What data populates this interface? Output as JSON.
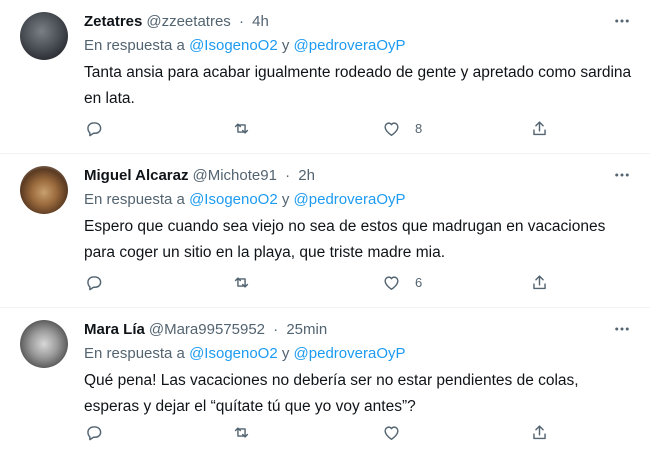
{
  "tweets": [
    {
      "name": "Zetatres",
      "handle": "@zzeetatres",
      "time": "4h",
      "reply_prefix": "En respuesta a",
      "mention1": "@IsogenoO2",
      "reply_join": "y",
      "mention2": "@pedroveraOyP",
      "text": "Tanta ansia para acabar igualmente rodeado de gente y apretado como sardina en lata.",
      "likes": "8"
    },
    {
      "name": "Miguel Alcaraz",
      "handle": "@Michote91",
      "time": "2h",
      "reply_prefix": "En respuesta a",
      "mention1": "@IsogenoO2",
      "reply_join": "y",
      "mention2": "@pedroveraOyP",
      "text": "Espero que cuando sea viejo no sea de estos que madrugan en vacaciones para coger un sitio en la playa, que triste madre mia.",
      "likes": "6"
    },
    {
      "name": "Mara Lía",
      "handle": "@Mara99575952",
      "time": "25min",
      "reply_prefix": "En respuesta a",
      "mention1": "@IsogenoO2",
      "reply_join": "y",
      "mention2": "@pedroveraOyP",
      "text": "Qué pena! Las vacaciones no debería ser no estar pendientes de colas, esperas y dejar el “quítate tú que yo voy antes”?",
      "likes": ""
    }
  ],
  "separator": "·",
  "colors": {
    "accent": "#1d9bf0",
    "secondary": "#536471",
    "text": "#0f1419"
  },
  "icons": [
    "more-icon",
    "reply-icon",
    "retweet-icon",
    "like-icon",
    "share-icon"
  ]
}
